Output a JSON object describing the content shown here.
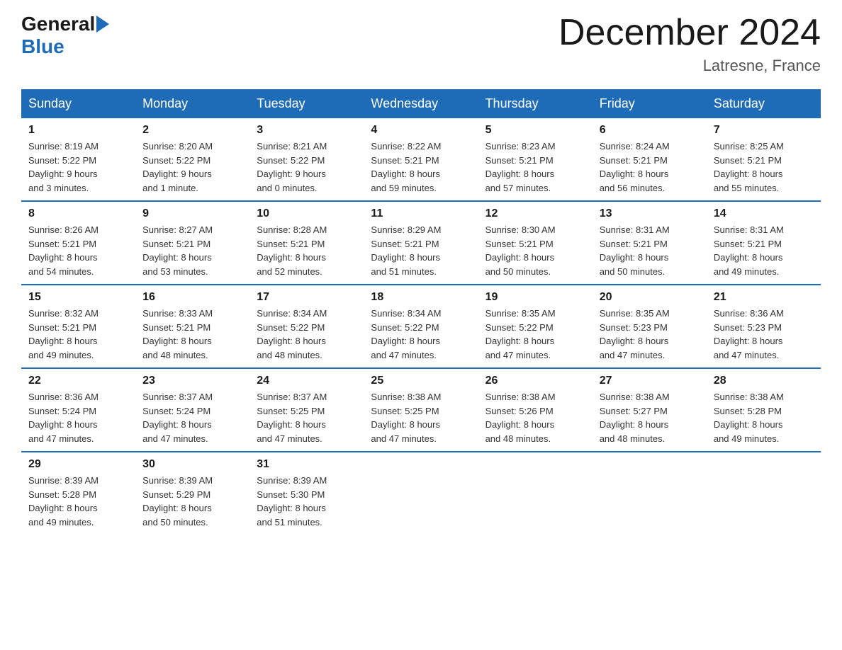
{
  "header": {
    "logo_general": "General",
    "logo_blue": "Blue",
    "title": "December 2024",
    "location": "Latresne, France"
  },
  "weekdays": [
    "Sunday",
    "Monday",
    "Tuesday",
    "Wednesday",
    "Thursday",
    "Friday",
    "Saturday"
  ],
  "weeks": [
    [
      {
        "day": "1",
        "sunrise": "8:19 AM",
        "sunset": "5:22 PM",
        "daylight": "9 hours and 3 minutes."
      },
      {
        "day": "2",
        "sunrise": "8:20 AM",
        "sunset": "5:22 PM",
        "daylight": "9 hours and 1 minute."
      },
      {
        "day": "3",
        "sunrise": "8:21 AM",
        "sunset": "5:22 PM",
        "daylight": "9 hours and 0 minutes."
      },
      {
        "day": "4",
        "sunrise": "8:22 AM",
        "sunset": "5:21 PM",
        "daylight": "8 hours and 59 minutes."
      },
      {
        "day": "5",
        "sunrise": "8:23 AM",
        "sunset": "5:21 PM",
        "daylight": "8 hours and 57 minutes."
      },
      {
        "day": "6",
        "sunrise": "8:24 AM",
        "sunset": "5:21 PM",
        "daylight": "8 hours and 56 minutes."
      },
      {
        "day": "7",
        "sunrise": "8:25 AM",
        "sunset": "5:21 PM",
        "daylight": "8 hours and 55 minutes."
      }
    ],
    [
      {
        "day": "8",
        "sunrise": "8:26 AM",
        "sunset": "5:21 PM",
        "daylight": "8 hours and 54 minutes."
      },
      {
        "day": "9",
        "sunrise": "8:27 AM",
        "sunset": "5:21 PM",
        "daylight": "8 hours and 53 minutes."
      },
      {
        "day": "10",
        "sunrise": "8:28 AM",
        "sunset": "5:21 PM",
        "daylight": "8 hours and 52 minutes."
      },
      {
        "day": "11",
        "sunrise": "8:29 AM",
        "sunset": "5:21 PM",
        "daylight": "8 hours and 51 minutes."
      },
      {
        "day": "12",
        "sunrise": "8:30 AM",
        "sunset": "5:21 PM",
        "daylight": "8 hours and 50 minutes."
      },
      {
        "day": "13",
        "sunrise": "8:31 AM",
        "sunset": "5:21 PM",
        "daylight": "8 hours and 50 minutes."
      },
      {
        "day": "14",
        "sunrise": "8:31 AM",
        "sunset": "5:21 PM",
        "daylight": "8 hours and 49 minutes."
      }
    ],
    [
      {
        "day": "15",
        "sunrise": "8:32 AM",
        "sunset": "5:21 PM",
        "daylight": "8 hours and 49 minutes."
      },
      {
        "day": "16",
        "sunrise": "8:33 AM",
        "sunset": "5:21 PM",
        "daylight": "8 hours and 48 minutes."
      },
      {
        "day": "17",
        "sunrise": "8:34 AM",
        "sunset": "5:22 PM",
        "daylight": "8 hours and 48 minutes."
      },
      {
        "day": "18",
        "sunrise": "8:34 AM",
        "sunset": "5:22 PM",
        "daylight": "8 hours and 47 minutes."
      },
      {
        "day": "19",
        "sunrise": "8:35 AM",
        "sunset": "5:22 PM",
        "daylight": "8 hours and 47 minutes."
      },
      {
        "day": "20",
        "sunrise": "8:35 AM",
        "sunset": "5:23 PM",
        "daylight": "8 hours and 47 minutes."
      },
      {
        "day": "21",
        "sunrise": "8:36 AM",
        "sunset": "5:23 PM",
        "daylight": "8 hours and 47 minutes."
      }
    ],
    [
      {
        "day": "22",
        "sunrise": "8:36 AM",
        "sunset": "5:24 PM",
        "daylight": "8 hours and 47 minutes."
      },
      {
        "day": "23",
        "sunrise": "8:37 AM",
        "sunset": "5:24 PM",
        "daylight": "8 hours and 47 minutes."
      },
      {
        "day": "24",
        "sunrise": "8:37 AM",
        "sunset": "5:25 PM",
        "daylight": "8 hours and 47 minutes."
      },
      {
        "day": "25",
        "sunrise": "8:38 AM",
        "sunset": "5:25 PM",
        "daylight": "8 hours and 47 minutes."
      },
      {
        "day": "26",
        "sunrise": "8:38 AM",
        "sunset": "5:26 PM",
        "daylight": "8 hours and 48 minutes."
      },
      {
        "day": "27",
        "sunrise": "8:38 AM",
        "sunset": "5:27 PM",
        "daylight": "8 hours and 48 minutes."
      },
      {
        "day": "28",
        "sunrise": "8:38 AM",
        "sunset": "5:28 PM",
        "daylight": "8 hours and 49 minutes."
      }
    ],
    [
      {
        "day": "29",
        "sunrise": "8:39 AM",
        "sunset": "5:28 PM",
        "daylight": "8 hours and 49 minutes."
      },
      {
        "day": "30",
        "sunrise": "8:39 AM",
        "sunset": "5:29 PM",
        "daylight": "8 hours and 50 minutes."
      },
      {
        "day": "31",
        "sunrise": "8:39 AM",
        "sunset": "5:30 PM",
        "daylight": "8 hours and 51 minutes."
      },
      null,
      null,
      null,
      null
    ]
  ],
  "labels": {
    "sunrise": "Sunrise:",
    "sunset": "Sunset:",
    "daylight": "Daylight:"
  }
}
